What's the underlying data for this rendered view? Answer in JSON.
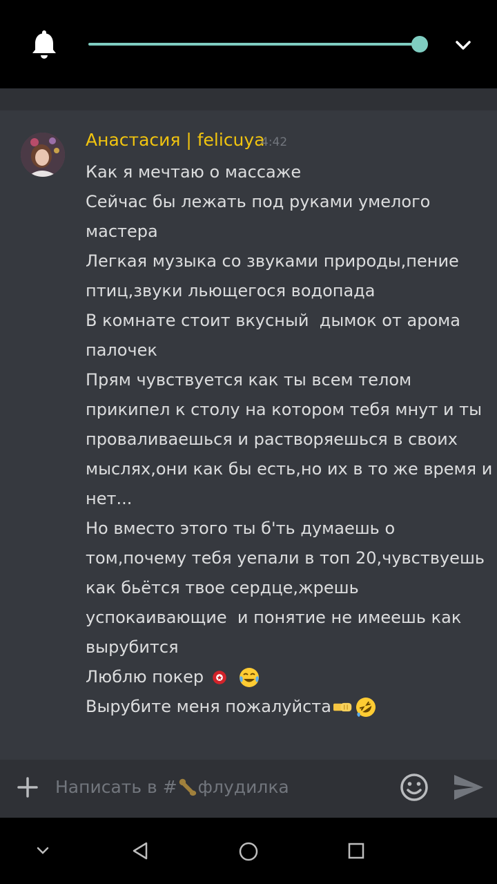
{
  "header": {
    "volume_level": 1.0,
    "accent_color": "#7fcdc1",
    "icons": [
      "bell-icon",
      "chevron-down-icon"
    ]
  },
  "message": {
    "author": "Анастасия | felicuya",
    "time": "4:42",
    "author_color": "#f1c40f",
    "lines": [
      "Как я мечтаю о массаже",
      "Сейчас бы лежать под руками умелого",
      "мастера",
      "Легкая музыка со звуками природы,пение",
      "птиц,звуки льющегося водопада",
      "В комнате стоит вкусный  дымок от арома",
      "палочек",
      "Прям чувствуется как ты всем телом",
      "прикипел к столу на котором тебя мнут и ты",
      "проваливаешься и растворяешься в своих",
      "мыслях,они как бы есть,но их в то же время и",
      "нет...",
      "Но вместо этого ты б'ть думаешь о",
      "том,почему тебя уепали в топ 20,чувствуешь",
      "как бьётся твое сердце,жрешь",
      "успокаивающие  и понятие не имеешь как",
      "вырубится"
    ],
    "poker_line": "Люблю покер ",
    "last_line": "Вырубите меня пожалуйста"
  },
  "input": {
    "placeholder_prefix": "Написать в #",
    "placeholder_channel": "флудилка"
  },
  "navbar": {
    "icons": [
      "nav-hide-icon",
      "back-icon",
      "home-icon",
      "recents-icon"
    ]
  }
}
